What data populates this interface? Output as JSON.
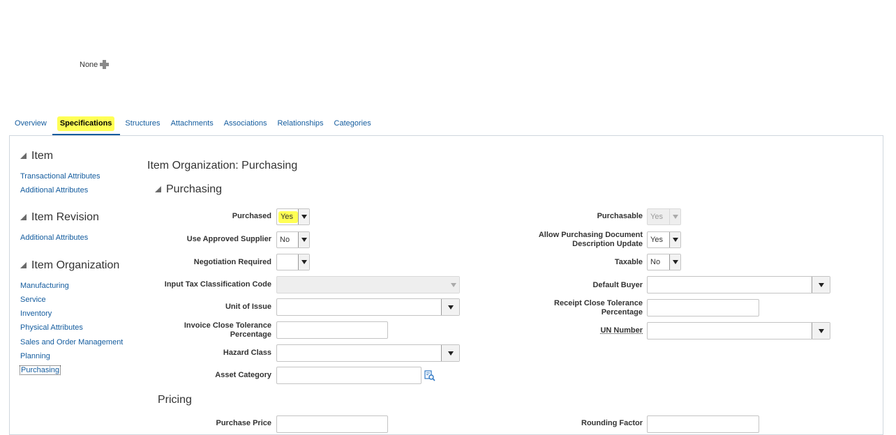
{
  "header": {
    "none_label": "None",
    "add_icon": "plus-icon"
  },
  "tabs": [
    {
      "label": "Overview"
    },
    {
      "label": "Specifications",
      "active": true
    },
    {
      "label": "Structures"
    },
    {
      "label": "Attachments"
    },
    {
      "label": "Associations"
    },
    {
      "label": "Relationships"
    },
    {
      "label": "Categories"
    }
  ],
  "sidebar": {
    "item": {
      "title": "Item",
      "links": [
        "Transactional Attributes",
        "Additional Attributes"
      ]
    },
    "item_revision": {
      "title": "Item Revision",
      "links": [
        "Additional Attributes"
      ]
    },
    "item_organization": {
      "title": "Item Organization",
      "links": [
        "Manufacturing",
        "Service",
        "Inventory",
        "Physical Attributes",
        "Sales and Order Management",
        "Planning",
        "Purchasing"
      ]
    }
  },
  "main": {
    "title": "Item Organization: Purchasing",
    "purchasing_section": "Purchasing",
    "pricing_section": "Pricing"
  },
  "fields": {
    "purchased": {
      "label": "Purchased",
      "value": "Yes"
    },
    "use_approved_supplier": {
      "label": "Use Approved Supplier",
      "value": "No"
    },
    "negotiation_required": {
      "label": "Negotiation Required",
      "value": ""
    },
    "input_tax_classification_code": {
      "label": "Input Tax Classification Code",
      "value": ""
    },
    "unit_of_issue": {
      "label": "Unit of Issue",
      "value": ""
    },
    "invoice_close_tolerance": {
      "label_line1": "Invoice Close Tolerance",
      "label_line2": "Percentage",
      "value": ""
    },
    "hazard_class": {
      "label": "Hazard Class",
      "value": ""
    },
    "asset_category": {
      "label": "Asset Category",
      "value": ""
    },
    "purchasable": {
      "label": "Purchasable",
      "value": "Yes"
    },
    "allow_purchasing_doc_desc_update": {
      "label_line1": "Allow Purchasing Document",
      "label_line2": "Description Update",
      "value": "Yes"
    },
    "taxable": {
      "label": "Taxable",
      "value": "No"
    },
    "default_buyer": {
      "label": "Default Buyer",
      "value": ""
    },
    "receipt_close_tolerance": {
      "label_line1": "Receipt Close Tolerance",
      "label_line2": "Percentage",
      "value": ""
    },
    "un_number": {
      "label": "UN Number",
      "value": ""
    },
    "purchase_price": {
      "label": "Purchase Price",
      "value": ""
    },
    "rounding_factor": {
      "label": "Rounding Factor",
      "value": ""
    }
  },
  "colors": {
    "link": "#145c9e",
    "highlight": "#ffff55"
  }
}
